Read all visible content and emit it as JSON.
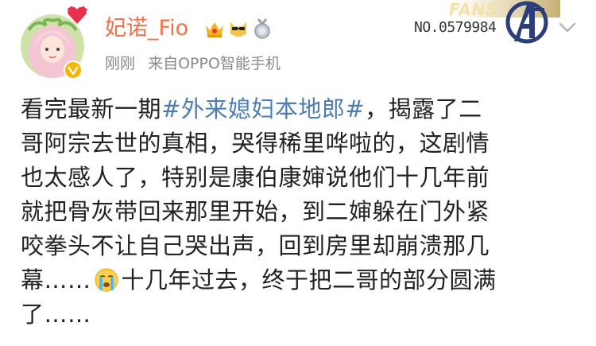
{
  "user": {
    "name": "妃诺_Fio",
    "badges": [
      "crown-badge-icon",
      "sunglasses-cat-badge-icon",
      "silver-medal-badge-icon"
    ],
    "verified_icon": "verified-v-icon"
  },
  "post_meta": {
    "time": "刚刚",
    "source": "来自OPPO智能手机"
  },
  "fans_card": {
    "label": "FANS",
    "number": "NO.0579984"
  },
  "post": {
    "lines": [
      {
        "before": "看完最新一期",
        "hashtag": "#外来媳妇本地郎#",
        "after": "，揭露了二"
      },
      {
        "text": "哥阿宗去世的真相，哭得稀里哗啦的，这剧情"
      },
      {
        "text": "也太感人了，特别是康伯康婶说他们十几年前"
      },
      {
        "text": "就把骨灰带回来那里开始，到二婶躲在门外紧"
      },
      {
        "text": "咬拳头不让自己哭出声，回到房里却崩溃那几"
      },
      {
        "before": "幕……",
        "emoji": "crying-face-icon",
        "after": "十几年过去，终于把二哥的部分圆满"
      },
      {
        "text": "了……"
      }
    ]
  },
  "colors": {
    "username": "#eb7350",
    "hashtag": "#507daf",
    "meta": "#8a8a8a",
    "body_text": "#222222"
  }
}
